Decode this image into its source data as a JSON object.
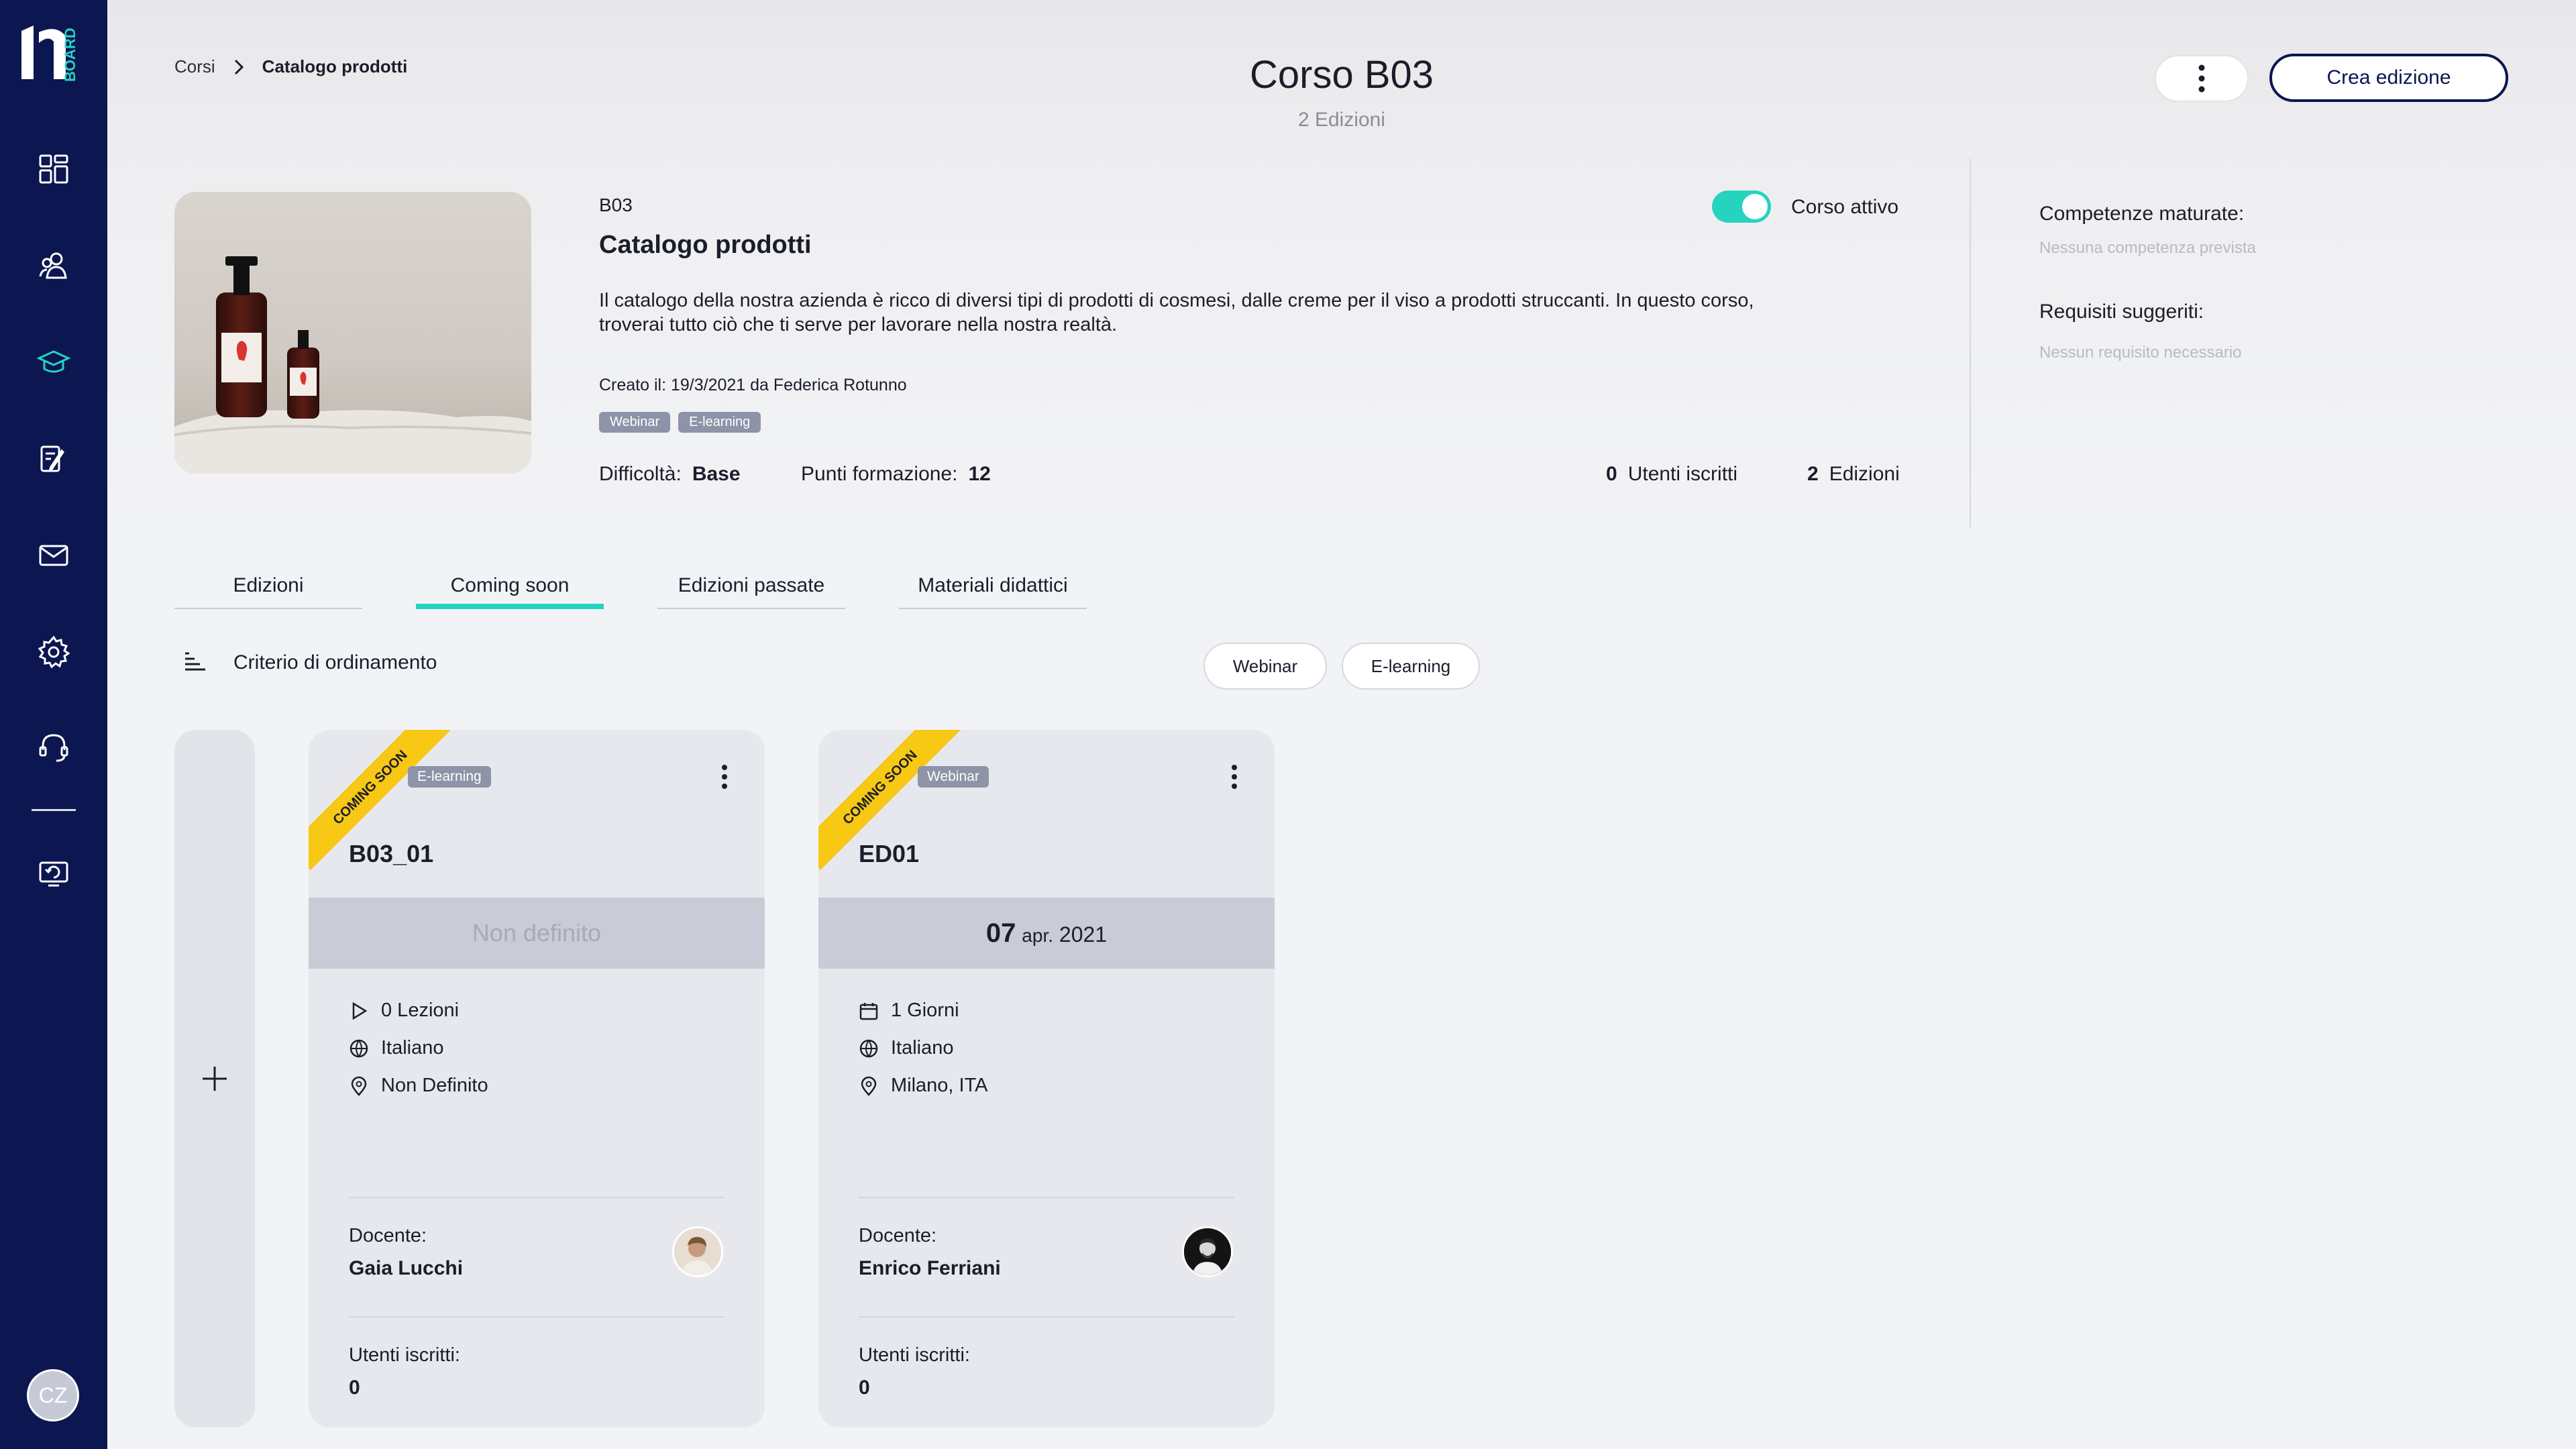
{
  "brand": {
    "logo_text": "BOARD",
    "accent": "#26d3bf",
    "sidebar_bg": "#0c1650",
    "ribbon_color": "#f7c814"
  },
  "sidebar": {
    "items": [
      {
        "name": "dashboard-icon"
      },
      {
        "name": "users-icon"
      },
      {
        "name": "courses-icon",
        "active": true
      },
      {
        "name": "exercises-icon"
      },
      {
        "name": "mail-icon"
      },
      {
        "name": "settings-icon"
      },
      {
        "name": "support-icon"
      },
      {
        "name": "switch-icon"
      }
    ],
    "user_initials": "CZ"
  },
  "breadcrumb": {
    "items": [
      "Corsi",
      "Catalogo prodotti"
    ]
  },
  "header": {
    "title": "Corso B03",
    "subtitle": "2 Edizioni",
    "create_label": "Crea edizione"
  },
  "course": {
    "code": "B03",
    "name": "Catalogo prodotti",
    "description_line1": "Il catalogo della nostra azienda è ricco di diversi tipi di prodotti di cosmesi, dalle creme per il viso a prodotti struccanti. In questo corso,",
    "description_line2": "troverai tutto ciò che ti serve per lavorare nella nostra realtà.",
    "created": "Creato il: 19/3/2021 da Federica Rotunno",
    "tags": [
      "Webinar",
      "E-learning"
    ],
    "difficulty_label": "Difficoltà:",
    "difficulty_value": "Base",
    "points_label": "Punti formazione:",
    "points_value": "12",
    "users_count": "0",
    "users_label": "Utenti iscritti",
    "editions_count": "2",
    "editions_label": "Edizioni",
    "active_label": "Corso attivo",
    "active": true
  },
  "side_panel": {
    "skills_title": "Competenze maturate:",
    "skills_empty": "Nessuna competenza prevista",
    "req_title": "Requisiti suggeriti:",
    "req_empty": "Nessun requisito necessario"
  },
  "tabs": [
    {
      "label": "Edizioni",
      "active": false
    },
    {
      "label": "Coming soon",
      "active": true
    },
    {
      "label": "Edizioni passate",
      "active": false
    },
    {
      "label": "Materiali didattici",
      "active": false
    }
  ],
  "sort": {
    "label": "Criterio di ordinamento"
  },
  "filters": [
    "Webinar",
    "E-learning"
  ],
  "cards": [
    {
      "ribbon": "COMING SOON",
      "tag": "E-learning",
      "title": "B03_01",
      "band_text": "Non definito",
      "info1": "0 Lezioni",
      "info2": "Italiano",
      "info3": "Non Definito",
      "teacher_label": "Docente:",
      "teacher": "Gaia Lucchi",
      "users_label": "Utenti iscritti:",
      "users": "0"
    },
    {
      "ribbon": "COMING SOON",
      "tag": "Webinar",
      "title": "ED01",
      "band_day": "07",
      "band_month": "apr.",
      "band_year": "2021",
      "info1": "1 Giorni",
      "info2": "Italiano",
      "info3": "Milano, ITA",
      "teacher_label": "Docente:",
      "teacher": "Enrico Ferriani",
      "users_label": "Utenti iscritti:",
      "users": "0"
    }
  ]
}
